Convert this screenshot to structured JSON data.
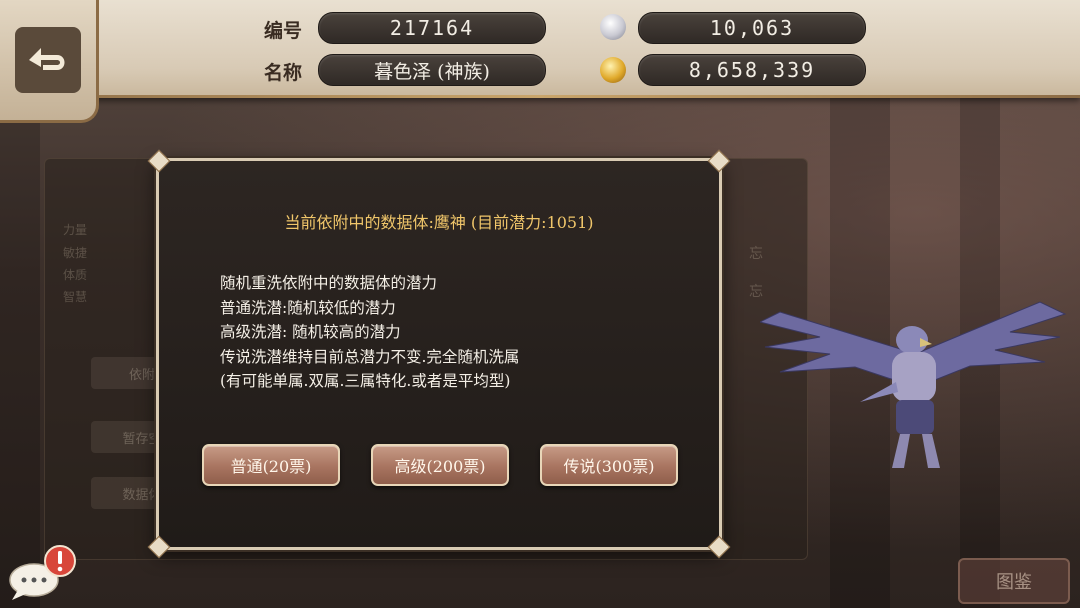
{
  "header": {
    "id_label": "编号",
    "id_value": "217164",
    "name_label": "名称",
    "name_value": "暮色泽 (神族)",
    "ticket_value": "10,063",
    "gold_value": "8,658,339"
  },
  "background": {
    "stat_labels": [
      "力量",
      "敏捷",
      "体质",
      "智慧"
    ],
    "side_buttons": [
      "依附",
      "暂存空",
      "数据体"
    ],
    "forget_labels": [
      "忘",
      "忘"
    ],
    "dex_label": "图鉴"
  },
  "dialog": {
    "title": "当前依附中的数据体:鹰神 (目前潜力:1051)",
    "lines": [
      "随机重洗依附中的数据体的潜力",
      "普通洗潜:随机较低的潜力",
      "高级洗潜: 随机较高的潜力",
      "传说洗潜维持目前总潜力不变.完全随机洗属",
      "(有可能单属.双属.三属特化.或者是平均型)"
    ],
    "buttons": {
      "normal": "普通(20票)",
      "advanced": "高级(200票)",
      "legend": "传说(300票)"
    }
  },
  "colors": {
    "dialog_title": "#f0c66a",
    "button_fill": "#a87460",
    "panel_border": "#d9cbb3"
  },
  "icons": [
    "back-arrow-icon",
    "ticket-icon",
    "gold-coin-icon",
    "chat-bubble-icon",
    "alert-icon"
  ]
}
